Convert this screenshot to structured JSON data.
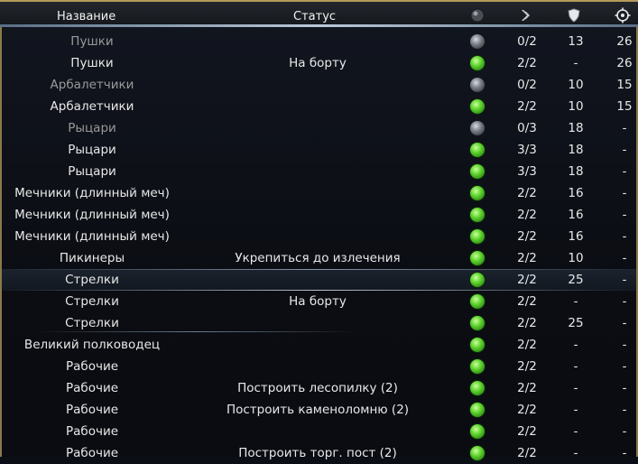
{
  "header": {
    "name_label": "Название",
    "status_label": "Статус",
    "icons": [
      "health-dot-icon",
      "movement-icon",
      "shield-icon",
      "target-icon"
    ]
  },
  "rows": [
    {
      "name": "Пушки",
      "status": "",
      "state": "off",
      "move": "0/2",
      "armor": "13",
      "range": "26",
      "dim": true
    },
    {
      "name": "Пушки",
      "status": "На борту",
      "state": "on",
      "move": "2/2",
      "armor": "-",
      "range": "26",
      "dim": false
    },
    {
      "name": "Арбалетчики",
      "status": "",
      "state": "off",
      "move": "0/2",
      "armor": "10",
      "range": "15",
      "dim": true
    },
    {
      "name": "Арбалетчики",
      "status": "",
      "state": "on",
      "move": "2/2",
      "armor": "10",
      "range": "15",
      "dim": false
    },
    {
      "name": "Рыцари",
      "status": "",
      "state": "off",
      "move": "0/3",
      "armor": "18",
      "range": "-",
      "dim": true
    },
    {
      "name": "Рыцари",
      "status": "",
      "state": "on",
      "move": "3/3",
      "armor": "18",
      "range": "-",
      "dim": false
    },
    {
      "name": "Рыцари",
      "status": "",
      "state": "on",
      "move": "3/3",
      "armor": "18",
      "range": "-",
      "dim": false
    },
    {
      "name": "Мечники (длинный меч)",
      "status": "",
      "state": "on",
      "move": "2/2",
      "armor": "16",
      "range": "-",
      "dim": false
    },
    {
      "name": "Мечники (длинный меч)",
      "status": "",
      "state": "on",
      "move": "2/2",
      "armor": "16",
      "range": "-",
      "dim": false
    },
    {
      "name": "Мечники (длинный меч)",
      "status": "",
      "state": "on",
      "move": "2/2",
      "armor": "16",
      "range": "-",
      "dim": false
    },
    {
      "name": "Пикинеры",
      "status": "Укрепиться до излечения",
      "state": "on",
      "move": "2/2",
      "armor": "10",
      "range": "-",
      "dim": false
    },
    {
      "name": "Стрелки",
      "status": "",
      "state": "on",
      "move": "2/2",
      "armor": "25",
      "range": "-",
      "dim": false,
      "selected": true
    },
    {
      "name": "Стрелки",
      "status": "На борту",
      "state": "on",
      "move": "2/2",
      "armor": "-",
      "range": "-",
      "dim": false
    },
    {
      "name": "Стрелки",
      "status": "",
      "state": "on",
      "move": "2/2",
      "armor": "25",
      "range": "-",
      "dim": false
    },
    {
      "name": "Великий полководец",
      "status": "",
      "state": "on",
      "move": "2/2",
      "armor": "-",
      "range": "-",
      "dim": false
    },
    {
      "name": "Рабочие",
      "status": "",
      "state": "on",
      "move": "2/2",
      "armor": "-",
      "range": "-",
      "dim": false
    },
    {
      "name": "Рабочие",
      "status": "Построить лесопилку (2)",
      "state": "on",
      "move": "2/2",
      "armor": "-",
      "range": "-",
      "dim": false
    },
    {
      "name": "Рабочие",
      "status": "Построить каменоломню (2)",
      "state": "on",
      "move": "2/2",
      "armor": "-",
      "range": "-",
      "dim": false
    },
    {
      "name": "Рабочие",
      "status": "",
      "state": "on",
      "move": "2/2",
      "armor": "-",
      "range": "-",
      "dim": false
    },
    {
      "name": "Рабочие",
      "status": "Построить торг. пост (2)",
      "state": "on",
      "move": "2/2",
      "armor": "-",
      "range": "-",
      "dim": false
    }
  ]
}
